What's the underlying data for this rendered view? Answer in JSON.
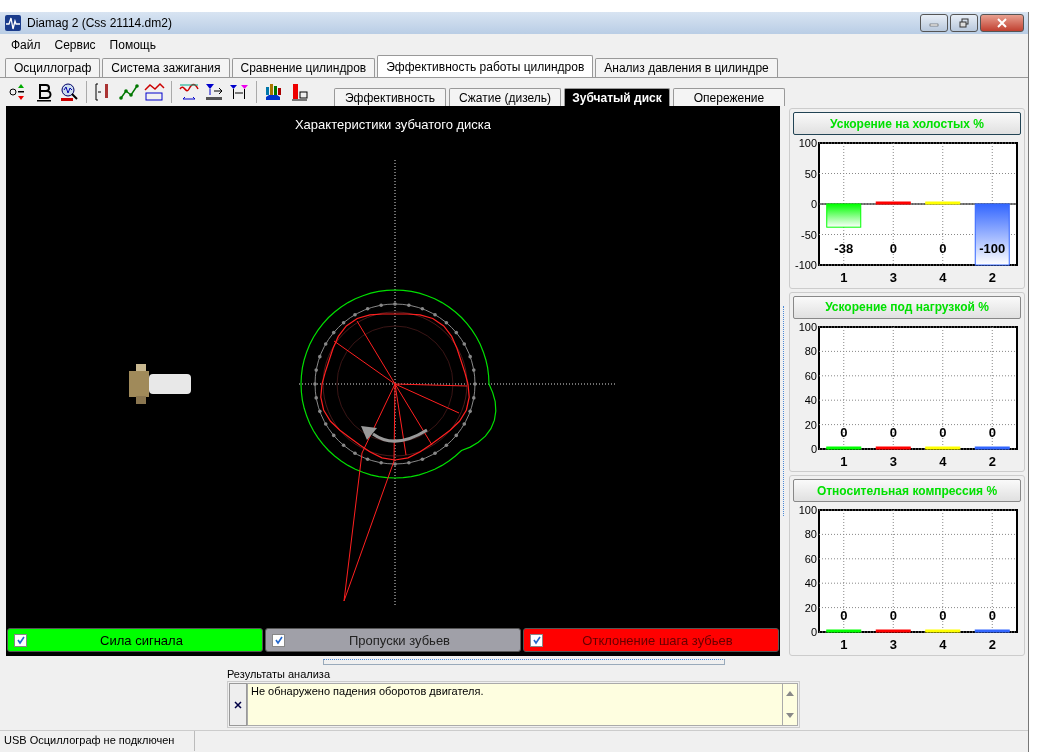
{
  "window": {
    "title": "Diamag 2 (Css 21114.dm2)"
  },
  "menu": [
    "Файл",
    "Сервис",
    "Помощь"
  ],
  "tabs": [
    {
      "label": "Осциллограф",
      "selected": false
    },
    {
      "label": "Система зажигания",
      "selected": false
    },
    {
      "label": "Сравнение цилиндров",
      "selected": false
    },
    {
      "label": "Эффективность работы цилиндров",
      "selected": true
    },
    {
      "label": "Анализ давления в цилиндре",
      "selected": false
    }
  ],
  "subtabs": [
    {
      "label": "Эффективность",
      "selected": false
    },
    {
      "label": "Сжатие (дизель)",
      "selected": false
    },
    {
      "label": "Зубчатый диск",
      "selected": true
    },
    {
      "label": "Опережение",
      "selected": false
    }
  ],
  "plot": {
    "title": "Характеристики зубчатого диска"
  },
  "legend": [
    {
      "label": "Сила сигнала",
      "checked": true,
      "color": "#00ff00"
    },
    {
      "label": "Пропуски зубьев",
      "checked": true,
      "color": "#a0a0a8"
    },
    {
      "label": "Отклонение шага зубьев",
      "checked": true,
      "color": "#ff0000"
    }
  ],
  "charts": [
    {
      "title": "Ускорение на холостых %",
      "chart_data": {
        "type": "bar",
        "grid": true,
        "categories": [
          "1",
          "3",
          "4",
          "2"
        ],
        "stacked": true,
        "data_labels": true,
        "ylim": [
          -100,
          100
        ],
        "yticks": [
          -100,
          -50,
          0,
          50,
          100
        ],
        "series": [
          {
            "color": "#00ff00",
            "values": [
              -38,
              null,
              null,
              null
            ]
          },
          {
            "color": "#ff0000",
            "values": [
              null,
              0,
              null,
              null
            ]
          },
          {
            "color": "#ffff00",
            "values": [
              null,
              null,
              0,
              null
            ]
          },
          {
            "color": "#3366ff",
            "values": [
              null,
              null,
              null,
              -100
            ]
          }
        ]
      }
    },
    {
      "title": "Ускорение под нагрузкой %",
      "chart_data": {
        "type": "bar",
        "grid": true,
        "categories": [
          "1",
          "3",
          "4",
          "2"
        ],
        "stacked": true,
        "data_labels": true,
        "ylim": [
          0,
          100
        ],
        "yticks": [
          0,
          20,
          40,
          60,
          80,
          100
        ],
        "series": [
          {
            "color": "#00ff00",
            "values": [
              0,
              null,
              null,
              null
            ]
          },
          {
            "color": "#ff0000",
            "values": [
              null,
              0,
              null,
              null
            ]
          },
          {
            "color": "#ffff00",
            "values": [
              null,
              null,
              0,
              null
            ]
          },
          {
            "color": "#3366ff",
            "values": [
              null,
              null,
              null,
              0
            ]
          }
        ]
      }
    },
    {
      "title": "Относительная компрессия %",
      "chart_data": {
        "type": "bar",
        "grid": true,
        "categories": [
          "1",
          "3",
          "4",
          "2"
        ],
        "stacked": true,
        "data_labels": true,
        "ylim": [
          0,
          100
        ],
        "yticks": [
          0,
          20,
          40,
          60,
          80,
          100
        ],
        "series": [
          {
            "color": "#00ff00",
            "values": [
              0,
              null,
              null,
              null
            ]
          },
          {
            "color": "#ff0000",
            "values": [
              null,
              0,
              null,
              null
            ]
          },
          {
            "color": "#ffff00",
            "values": [
              null,
              null,
              0,
              null
            ]
          },
          {
            "color": "#3366ff",
            "values": [
              null,
              null,
              null,
              0
            ]
          }
        ]
      }
    }
  ],
  "results": {
    "label": "Результаты анализа",
    "text": "Не обнаружено падения оборотов двигателя."
  },
  "status_bar": "USB Осциллограф не подключен"
}
